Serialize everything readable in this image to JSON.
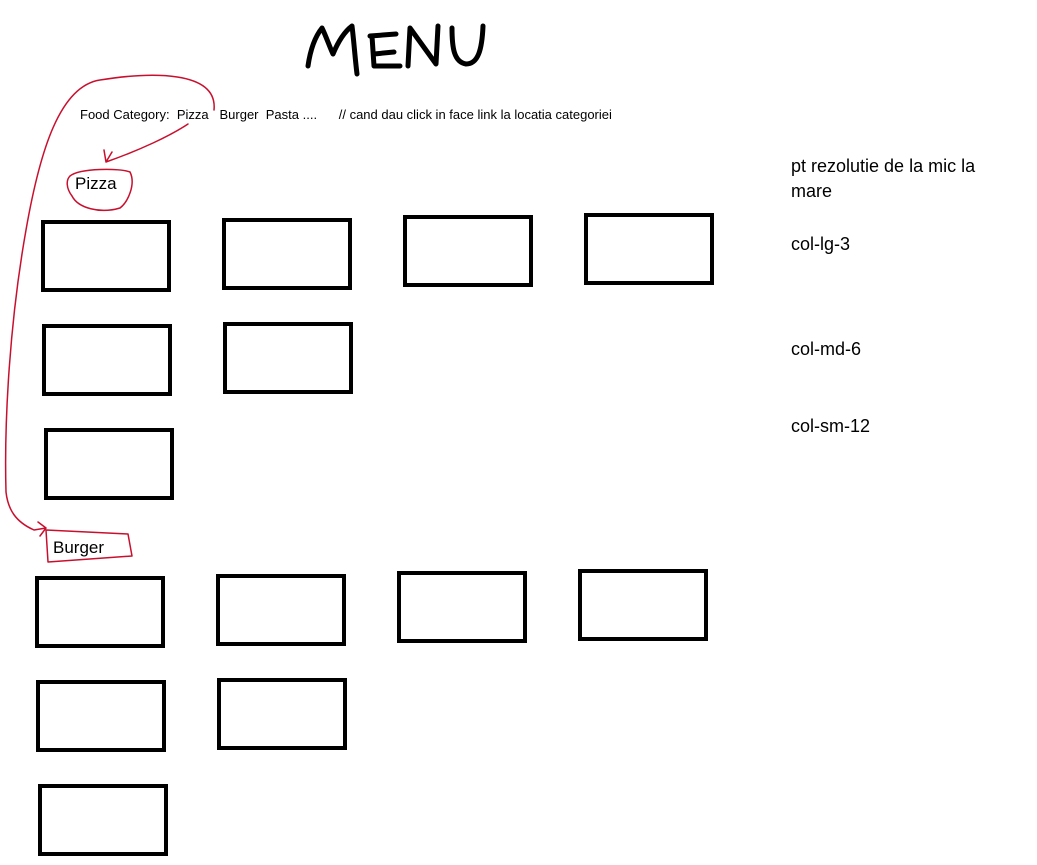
{
  "title": "MENU",
  "category_nav": {
    "prefix": "Food Category: ",
    "links": [
      "Pizza",
      "Burger",
      "Pasta ...."
    ],
    "comment": "// cand dau click in face link la locatia categoriei"
  },
  "sections": [
    {
      "label": "Pizza",
      "item_count": 7
    },
    {
      "label": "Burger",
      "item_count": 7
    }
  ],
  "notes": {
    "resolution": "pt rezolutie de la mic la mare",
    "lg": "col-lg-3",
    "md": "col-md-6",
    "sm": "col-sm-12"
  },
  "colors": {
    "annotation": "#c8102e",
    "box_border": "#000000"
  }
}
